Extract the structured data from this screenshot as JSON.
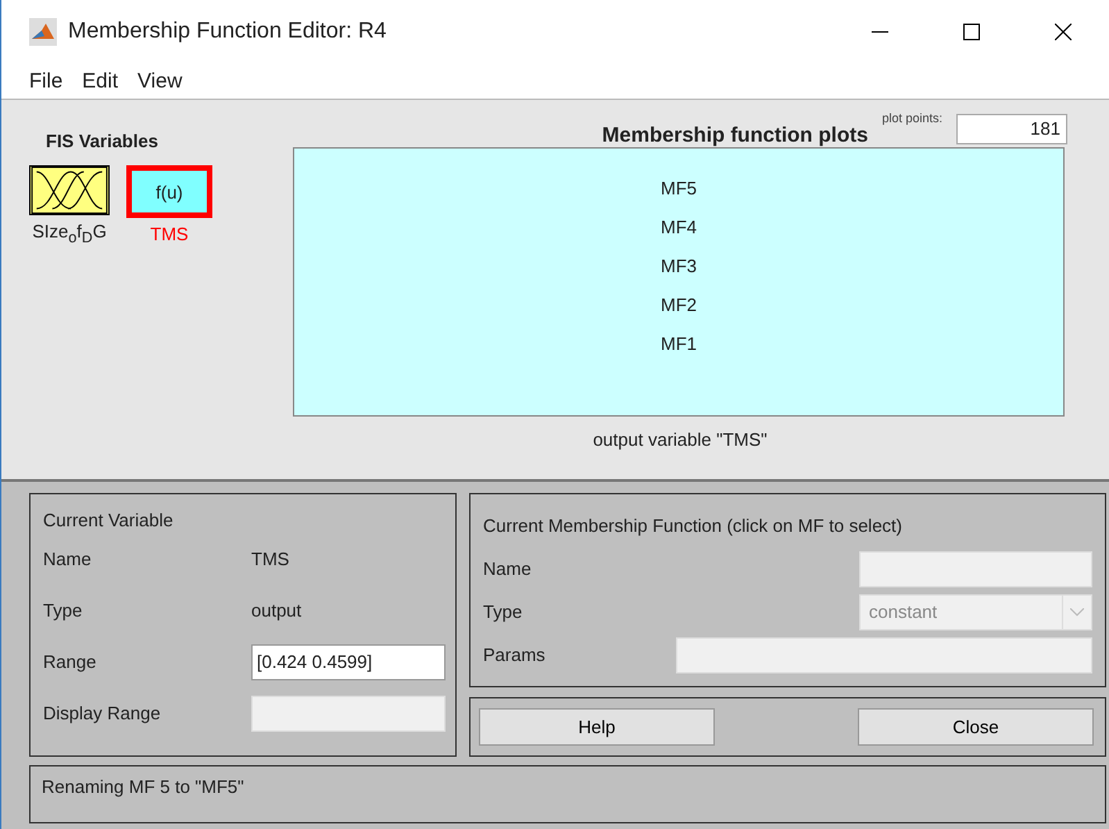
{
  "window": {
    "title": "Membership Function Editor: R4"
  },
  "menu": [
    "File",
    "Edit",
    "View"
  ],
  "fis_variables": {
    "title": "FIS Variables",
    "items": [
      {
        "kind": "input",
        "label": "SIze$_{o}$f$_{D}$G",
        "selected": false
      },
      {
        "kind": "output",
        "icon_text": "f(u)",
        "label": "TMS",
        "selected": true
      }
    ]
  },
  "plot": {
    "title": "Membership function plots",
    "plot_points_label": "plot points:",
    "plot_points": "181",
    "mf_labels": [
      "MF5",
      "MF4",
      "MF3",
      "MF2",
      "MF1"
    ],
    "caption": "output variable \"TMS\""
  },
  "current_variable": {
    "title": "Current Variable",
    "name_label": "Name",
    "name": "TMS",
    "type_label": "Type",
    "type": "output",
    "range_label": "Range",
    "range": "[0.424 0.4599]",
    "display_range_label": "Display Range"
  },
  "current_mf": {
    "title": "Current Membership Function (click on MF to select)",
    "name_label": "Name",
    "type_label": "Type",
    "type": "constant",
    "params_label": "Params"
  },
  "buttons": [
    "Help",
    "Close"
  ],
  "status": "Renaming MF 5 to \"MF5\""
}
